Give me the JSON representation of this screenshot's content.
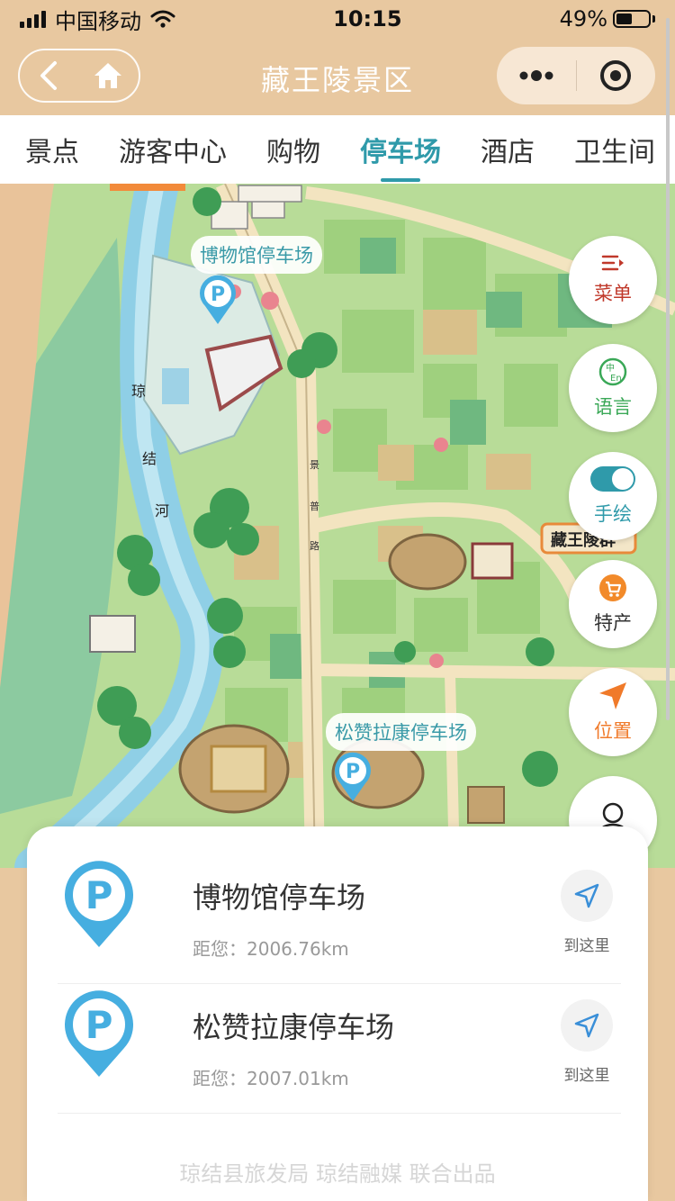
{
  "status": {
    "carrier": "中国移动",
    "time": "10:15",
    "battery": "49%",
    "battery_level": 0.49
  },
  "nav": {
    "title": "藏王陵景区",
    "back_icon": "chevron-left-icon",
    "home_icon": "home-icon",
    "more_icon": "more-dots-icon",
    "close_icon": "target-icon"
  },
  "tabs": [
    {
      "label": "景点"
    },
    {
      "label": "游客中心"
    },
    {
      "label": "购物"
    },
    {
      "label": "停车场",
      "active": true
    },
    {
      "label": "酒店"
    },
    {
      "label": "卫生间"
    }
  ],
  "map": {
    "labels": {
      "river": [
        "琼",
        "结",
        "河"
      ],
      "road": [
        "景",
        "普",
        "路"
      ],
      "site": "藏王陵群"
    },
    "parking_markers": [
      {
        "label": "博物馆停车场"
      },
      {
        "label": "松赞拉康停车场"
      }
    ]
  },
  "side_buttons": {
    "menu": "菜单",
    "language": "语言",
    "hand_drawn": "手绘",
    "specialty": "特产",
    "location": "位置"
  },
  "parking_list": [
    {
      "name": "博物馆停车场",
      "distance": "距您：2006.76km",
      "action": "到这里"
    },
    {
      "name": "松赞拉康停车场",
      "distance": "距您：2007.01km",
      "action": "到这里"
    }
  ],
  "footer": "琼结县旅发局 琼结融媒 联合出品",
  "colors": {
    "accent": "#2f9aaa",
    "pin": "#46aee0",
    "header": "#e8c8a0",
    "map_green": "#a8d48c",
    "river": "#8fcfe6"
  }
}
